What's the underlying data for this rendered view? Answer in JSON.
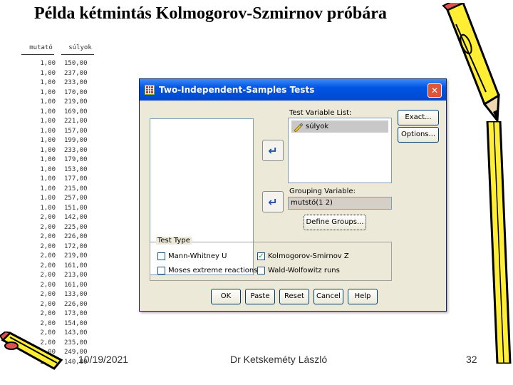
{
  "slide": {
    "title": "Példa kétmintás Kolmogorov-Szmirnov próbára"
  },
  "table": {
    "headers": [
      "mutató",
      "súlyok"
    ],
    "rows": [
      [
        "1,00",
        "150,00"
      ],
      [
        "1,00",
        "237,00"
      ],
      [
        "1,00",
        "233,00"
      ],
      [
        "1,00",
        "170,00"
      ],
      [
        "1,00",
        "219,00"
      ],
      [
        "1,00",
        "169,00"
      ],
      [
        "1,00",
        "221,00"
      ],
      [
        "1,00",
        "157,00"
      ],
      [
        "1,00",
        "199,00"
      ],
      [
        "1,00",
        "233,00"
      ],
      [
        "1,00",
        "179,00"
      ],
      [
        "1,00",
        "153,00"
      ],
      [
        "1,00",
        "177,00"
      ],
      [
        "1,00",
        "215,00"
      ],
      [
        "1,00",
        "257,00"
      ],
      [
        "1,00",
        "151,00"
      ],
      [
        "2,00",
        "142,00"
      ],
      [
        "2,00",
        "225,00"
      ],
      [
        "2,00",
        "226,00"
      ],
      [
        "2,00",
        "172,00"
      ],
      [
        "2,00",
        "219,00"
      ],
      [
        "2,00",
        "161,00"
      ],
      [
        "2,00",
        "213,00"
      ],
      [
        "2,00",
        "161,00"
      ],
      [
        "2,00",
        "133,00"
      ],
      [
        "2,00",
        "226,00"
      ],
      [
        "2,00",
        "173,00"
      ],
      [
        "2,00",
        "154,00"
      ],
      [
        "2,00",
        "143,00"
      ],
      [
        "2,00",
        "235,00"
      ],
      [
        "2,00",
        "249,00"
      ],
      [
        "2,00",
        "140,00"
      ]
    ]
  },
  "dialog": {
    "title": "Two-Independent-Samples Tests",
    "close_label": "✕",
    "test_variable_label": "Test Variable List:",
    "test_variables": [
      "súlyok"
    ],
    "grouping_label": "Grouping Variable:",
    "grouping_value": "mutstó(1 2)",
    "define_groups_label": "Define Groups...",
    "exact_label": "Exact...",
    "options_label": "Options...",
    "test_type_label": "Test Type",
    "tests": [
      {
        "label": "Mann-Whitney U",
        "checked": false
      },
      {
        "label": "Kolmogorov-Smirnov Z",
        "checked": true
      },
      {
        "label": "Moses extreme reactions",
        "checked": false
      },
      {
        "label": "Wald-Wolfowitz runs",
        "checked": false
      }
    ],
    "buttons": {
      "ok": "OK",
      "paste": "Paste",
      "reset": "Reset",
      "cancel": "Cancel",
      "help": "Help"
    },
    "check_mark": "✓",
    "arrow_glyph": "↵"
  },
  "footer": {
    "date": "10/19/2021",
    "author": "Dr Ketskeméty László",
    "page": "32"
  },
  "colors": {
    "titlebar": "#0054e3",
    "dialog_bg": "#ece9d8",
    "pencil_yellow": "#ffee33",
    "pencil_tip": "#e05050"
  }
}
